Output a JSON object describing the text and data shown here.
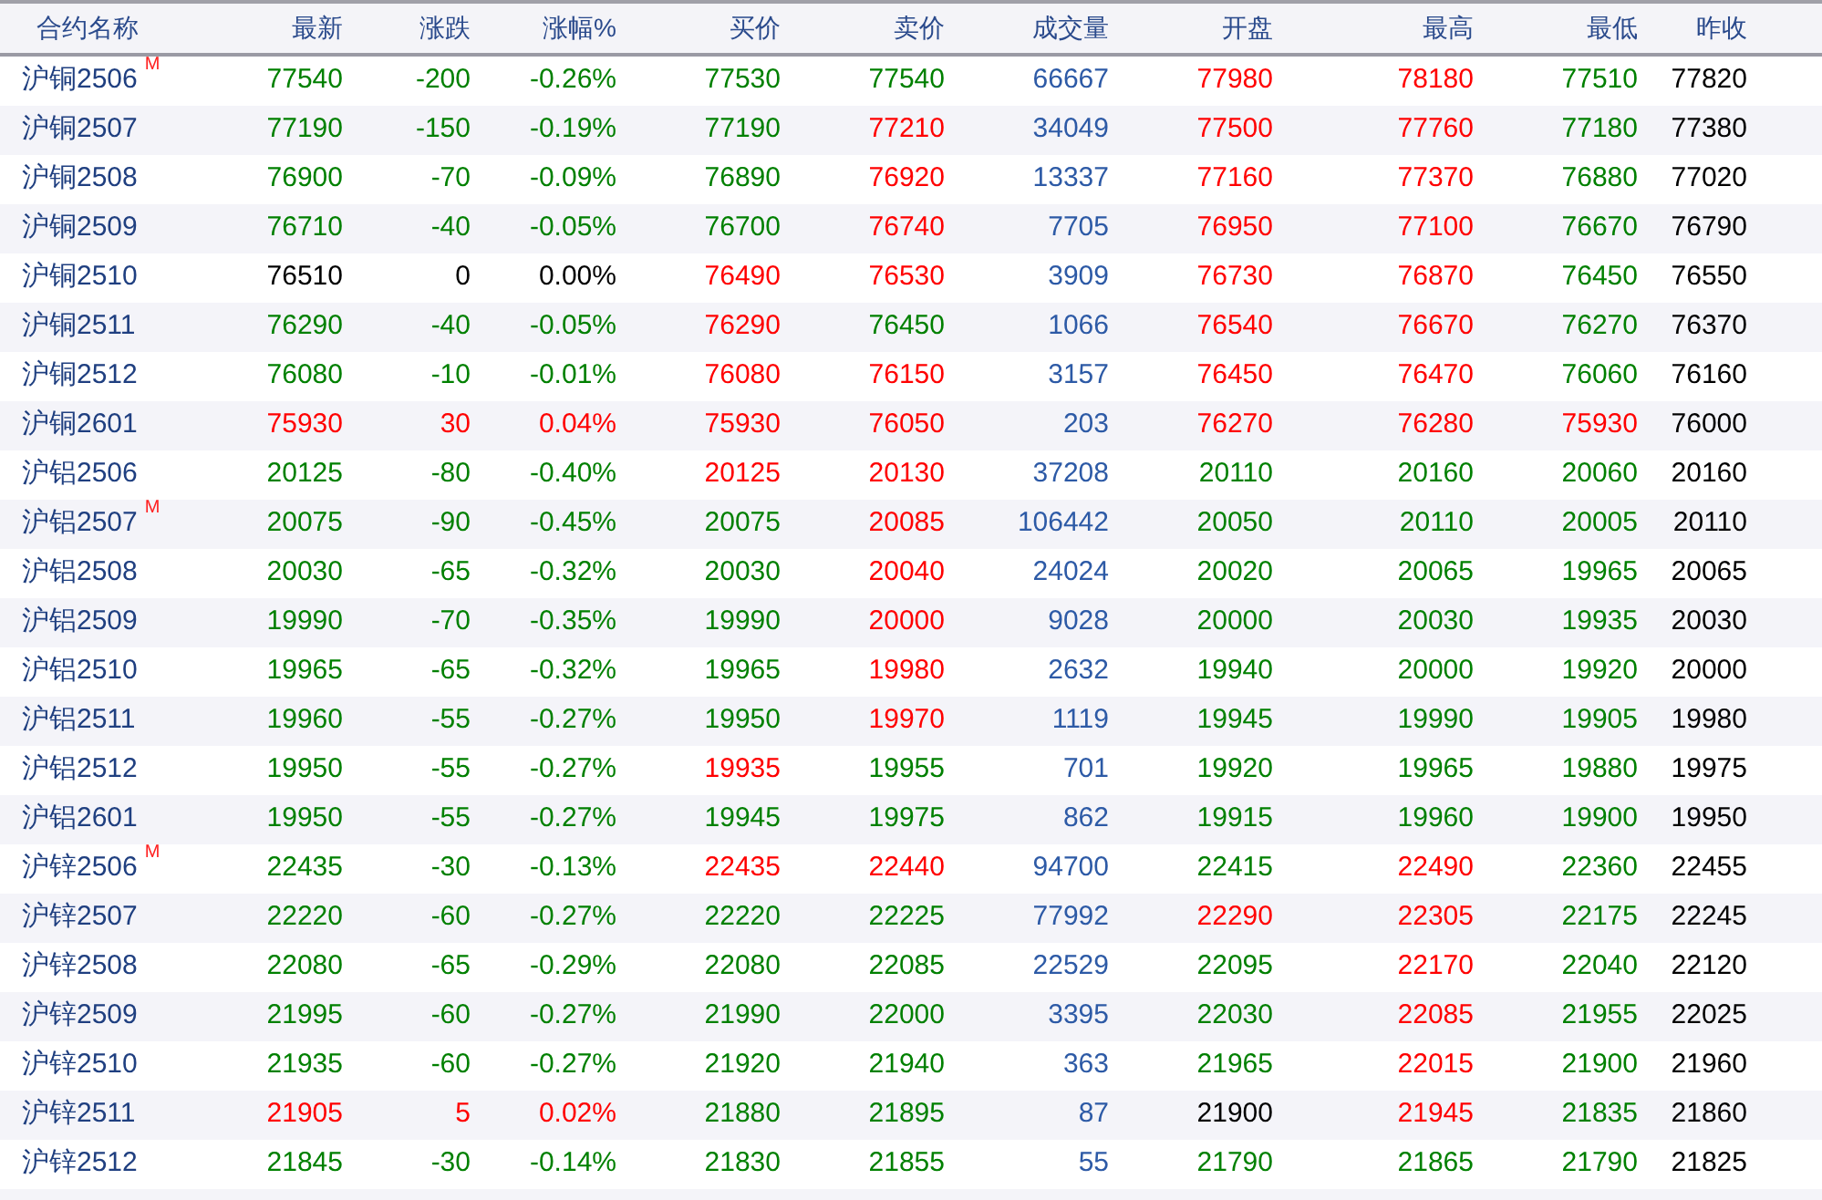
{
  "columns": [
    "合约名称",
    "最新",
    "涨跌",
    "涨幅%",
    "买价",
    "卖价",
    "成交量",
    "开盘",
    "最高",
    "最低",
    "昨收"
  ],
  "rows": [
    {
      "name": "沪铜2506",
      "badge": "M",
      "cells": [
        {
          "text": "77540",
          "color": "#008000"
        },
        {
          "text": "-200",
          "color": "#008000"
        },
        {
          "text": "-0.26%",
          "color": "#008000"
        },
        {
          "text": "77530",
          "color": "#008000"
        },
        {
          "text": "77540",
          "color": "#008000"
        }
      ],
      "volume": "66667",
      "range": [
        {
          "text": "77980",
          "color": "#ff0000"
        },
        {
          "text": "78180",
          "color": "#ff0000"
        },
        {
          "text": "77510",
          "color": "#008000"
        }
      ],
      "prev_close": "77820"
    },
    {
      "name": "沪铜2507",
      "cells": [
        {
          "text": "77190",
          "color": "#008000"
        },
        {
          "text": "-150",
          "color": "#008000"
        },
        {
          "text": "-0.19%",
          "color": "#008000"
        },
        {
          "text": "77190",
          "color": "#008000"
        },
        {
          "text": "77210",
          "color": "#ff0000"
        }
      ],
      "volume": "34049",
      "range": [
        {
          "text": "77500",
          "color": "#ff0000"
        },
        {
          "text": "77760",
          "color": "#ff0000"
        },
        {
          "text": "77180",
          "color": "#008000"
        }
      ],
      "prev_close": "77380"
    },
    {
      "name": "沪铜2508",
      "cells": [
        {
          "text": "76900",
          "color": "#008000"
        },
        {
          "text": "-70",
          "color": "#008000"
        },
        {
          "text": "-0.09%",
          "color": "#008000"
        },
        {
          "text": "76890",
          "color": "#008000"
        },
        {
          "text": "76920",
          "color": "#ff0000"
        }
      ],
      "volume": "13337",
      "range": [
        {
          "text": "77160",
          "color": "#ff0000"
        },
        {
          "text": "77370",
          "color": "#ff0000"
        },
        {
          "text": "76880",
          "color": "#008000"
        }
      ],
      "prev_close": "77020"
    },
    {
      "name": "沪铜2509",
      "cells": [
        {
          "text": "76710",
          "color": "#008000"
        },
        {
          "text": "-40",
          "color": "#008000"
        },
        {
          "text": "-0.05%",
          "color": "#008000"
        },
        {
          "text": "76700",
          "color": "#008000"
        },
        {
          "text": "76740",
          "color": "#ff0000"
        }
      ],
      "volume": "7705",
      "range": [
        {
          "text": "76950",
          "color": "#ff0000"
        },
        {
          "text": "77100",
          "color": "#ff0000"
        },
        {
          "text": "76670",
          "color": "#008000"
        }
      ],
      "prev_close": "76790"
    },
    {
      "name": "沪铜2510",
      "cells": [
        {
          "text": "76510",
          "color": "#000000"
        },
        {
          "text": "0",
          "color": "#000000"
        },
        {
          "text": "0.00%",
          "color": "#000000"
        },
        {
          "text": "76490",
          "color": "#ff0000"
        },
        {
          "text": "76530",
          "color": "#ff0000"
        }
      ],
      "volume": "3909",
      "range": [
        {
          "text": "76730",
          "color": "#ff0000"
        },
        {
          "text": "76870",
          "color": "#ff0000"
        },
        {
          "text": "76450",
          "color": "#008000"
        }
      ],
      "prev_close": "76550"
    },
    {
      "name": "沪铜2511",
      "cells": [
        {
          "text": "76290",
          "color": "#008000"
        },
        {
          "text": "-40",
          "color": "#008000"
        },
        {
          "text": "-0.05%",
          "color": "#008000"
        },
        {
          "text": "76290",
          "color": "#ff0000"
        },
        {
          "text": "76450",
          "color": "#008000"
        }
      ],
      "volume": "1066",
      "range": [
        {
          "text": "76540",
          "color": "#ff0000"
        },
        {
          "text": "76670",
          "color": "#ff0000"
        },
        {
          "text": "76270",
          "color": "#008000"
        }
      ],
      "prev_close": "76370"
    },
    {
      "name": "沪铜2512",
      "cells": [
        {
          "text": "76080",
          "color": "#008000"
        },
        {
          "text": "-10",
          "color": "#008000"
        },
        {
          "text": "-0.01%",
          "color": "#008000"
        },
        {
          "text": "76080",
          "color": "#ff0000"
        },
        {
          "text": "76150",
          "color": "#ff0000"
        }
      ],
      "volume": "3157",
      "range": [
        {
          "text": "76450",
          "color": "#ff0000"
        },
        {
          "text": "76470",
          "color": "#ff0000"
        },
        {
          "text": "76060",
          "color": "#008000"
        }
      ],
      "prev_close": "76160"
    },
    {
      "name": "沪铜2601",
      "cells": [
        {
          "text": "75930",
          "color": "#ff0000"
        },
        {
          "text": "30",
          "color": "#ff0000"
        },
        {
          "text": "0.04%",
          "color": "#ff0000"
        },
        {
          "text": "75930",
          "color": "#ff0000"
        },
        {
          "text": "76050",
          "color": "#ff0000"
        }
      ],
      "volume": "203",
      "range": [
        {
          "text": "76270",
          "color": "#ff0000"
        },
        {
          "text": "76280",
          "color": "#ff0000"
        },
        {
          "text": "75930",
          "color": "#ff0000"
        }
      ],
      "prev_close": "76000"
    },
    {
      "name": "沪铝2506",
      "cells": [
        {
          "text": "20125",
          "color": "#008000"
        },
        {
          "text": "-80",
          "color": "#008000"
        },
        {
          "text": "-0.40%",
          "color": "#008000"
        },
        {
          "text": "20125",
          "color": "#ff0000"
        },
        {
          "text": "20130",
          "color": "#ff0000"
        }
      ],
      "volume": "37208",
      "range": [
        {
          "text": "20110",
          "color": "#008000"
        },
        {
          "text": "20160",
          "color": "#008000"
        },
        {
          "text": "20060",
          "color": "#008000"
        }
      ],
      "prev_close": "20160"
    },
    {
      "name": "沪铝2507",
      "badge": "M",
      "cells": [
        {
          "text": "20075",
          "color": "#008000"
        },
        {
          "text": "-90",
          "color": "#008000"
        },
        {
          "text": "-0.45%",
          "color": "#008000"
        },
        {
          "text": "20075",
          "color": "#008000"
        },
        {
          "text": "20085",
          "color": "#ff0000"
        }
      ],
      "volume": "106442",
      "range": [
        {
          "text": "20050",
          "color": "#008000"
        },
        {
          "text": "20110",
          "color": "#008000"
        },
        {
          "text": "20005",
          "color": "#008000"
        }
      ],
      "prev_close": "20110"
    },
    {
      "name": "沪铝2508",
      "cells": [
        {
          "text": "20030",
          "color": "#008000"
        },
        {
          "text": "-65",
          "color": "#008000"
        },
        {
          "text": "-0.32%",
          "color": "#008000"
        },
        {
          "text": "20030",
          "color": "#008000"
        },
        {
          "text": "20040",
          "color": "#ff0000"
        }
      ],
      "volume": "24024",
      "range": [
        {
          "text": "20020",
          "color": "#008000"
        },
        {
          "text": "20065",
          "color": "#008000"
        },
        {
          "text": "19965",
          "color": "#008000"
        }
      ],
      "prev_close": "20065"
    },
    {
      "name": "沪铝2509",
      "cells": [
        {
          "text": "19990",
          "color": "#008000"
        },
        {
          "text": "-70",
          "color": "#008000"
        },
        {
          "text": "-0.35%",
          "color": "#008000"
        },
        {
          "text": "19990",
          "color": "#008000"
        },
        {
          "text": "20000",
          "color": "#ff0000"
        }
      ],
      "volume": "9028",
      "range": [
        {
          "text": "20000",
          "color": "#008000"
        },
        {
          "text": "20030",
          "color": "#008000"
        },
        {
          "text": "19935",
          "color": "#008000"
        }
      ],
      "prev_close": "20030"
    },
    {
      "name": "沪铝2510",
      "cells": [
        {
          "text": "19965",
          "color": "#008000"
        },
        {
          "text": "-65",
          "color": "#008000"
        },
        {
          "text": "-0.32%",
          "color": "#008000"
        },
        {
          "text": "19965",
          "color": "#008000"
        },
        {
          "text": "19980",
          "color": "#ff0000"
        }
      ],
      "volume": "2632",
      "range": [
        {
          "text": "19940",
          "color": "#008000"
        },
        {
          "text": "20000",
          "color": "#008000"
        },
        {
          "text": "19920",
          "color": "#008000"
        }
      ],
      "prev_close": "20000"
    },
    {
      "name": "沪铝2511",
      "cells": [
        {
          "text": "19960",
          "color": "#008000"
        },
        {
          "text": "-55",
          "color": "#008000"
        },
        {
          "text": "-0.27%",
          "color": "#008000"
        },
        {
          "text": "19950",
          "color": "#008000"
        },
        {
          "text": "19970",
          "color": "#ff0000"
        }
      ],
      "volume": "1119",
      "range": [
        {
          "text": "19945",
          "color": "#008000"
        },
        {
          "text": "19990",
          "color": "#008000"
        },
        {
          "text": "19905",
          "color": "#008000"
        }
      ],
      "prev_close": "19980"
    },
    {
      "name": "沪铝2512",
      "cells": [
        {
          "text": "19950",
          "color": "#008000"
        },
        {
          "text": "-55",
          "color": "#008000"
        },
        {
          "text": "-0.27%",
          "color": "#008000"
        },
        {
          "text": "19935",
          "color": "#ff0000"
        },
        {
          "text": "19955",
          "color": "#008000"
        }
      ],
      "volume": "701",
      "range": [
        {
          "text": "19920",
          "color": "#008000"
        },
        {
          "text": "19965",
          "color": "#008000"
        },
        {
          "text": "19880",
          "color": "#008000"
        }
      ],
      "prev_close": "19975"
    },
    {
      "name": "沪铝2601",
      "cells": [
        {
          "text": "19950",
          "color": "#008000"
        },
        {
          "text": "-55",
          "color": "#008000"
        },
        {
          "text": "-0.27%",
          "color": "#008000"
        },
        {
          "text": "19945",
          "color": "#008000"
        },
        {
          "text": "19975",
          "color": "#008000"
        }
      ],
      "volume": "862",
      "range": [
        {
          "text": "19915",
          "color": "#008000"
        },
        {
          "text": "19960",
          "color": "#008000"
        },
        {
          "text": "19900",
          "color": "#008000"
        }
      ],
      "prev_close": "19950"
    },
    {
      "name": "沪锌2506",
      "badge": "M",
      "cells": [
        {
          "text": "22435",
          "color": "#008000"
        },
        {
          "text": "-30",
          "color": "#008000"
        },
        {
          "text": "-0.13%",
          "color": "#008000"
        },
        {
          "text": "22435",
          "color": "#ff0000"
        },
        {
          "text": "22440",
          "color": "#ff0000"
        }
      ],
      "volume": "94700",
      "range": [
        {
          "text": "22415",
          "color": "#008000"
        },
        {
          "text": "22490",
          "color": "#ff0000"
        },
        {
          "text": "22360",
          "color": "#008000"
        }
      ],
      "prev_close": "22455"
    },
    {
      "name": "沪锌2507",
      "cells": [
        {
          "text": "22220",
          "color": "#008000"
        },
        {
          "text": "-60",
          "color": "#008000"
        },
        {
          "text": "-0.27%",
          "color": "#008000"
        },
        {
          "text": "22220",
          "color": "#008000"
        },
        {
          "text": "22225",
          "color": "#008000"
        }
      ],
      "volume": "77992",
      "range": [
        {
          "text": "22290",
          "color": "#ff0000"
        },
        {
          "text": "22305",
          "color": "#ff0000"
        },
        {
          "text": "22175",
          "color": "#008000"
        }
      ],
      "prev_close": "22245"
    },
    {
      "name": "沪锌2508",
      "cells": [
        {
          "text": "22080",
          "color": "#008000"
        },
        {
          "text": "-65",
          "color": "#008000"
        },
        {
          "text": "-0.29%",
          "color": "#008000"
        },
        {
          "text": "22080",
          "color": "#008000"
        },
        {
          "text": "22085",
          "color": "#008000"
        }
      ],
      "volume": "22529",
      "range": [
        {
          "text": "22095",
          "color": "#008000"
        },
        {
          "text": "22170",
          "color": "#ff0000"
        },
        {
          "text": "22040",
          "color": "#008000"
        }
      ],
      "prev_close": "22120"
    },
    {
      "name": "沪锌2509",
      "cells": [
        {
          "text": "21995",
          "color": "#008000"
        },
        {
          "text": "-60",
          "color": "#008000"
        },
        {
          "text": "-0.27%",
          "color": "#008000"
        },
        {
          "text": "21990",
          "color": "#008000"
        },
        {
          "text": "22000",
          "color": "#008000"
        }
      ],
      "volume": "3395",
      "range": [
        {
          "text": "22030",
          "color": "#008000"
        },
        {
          "text": "22085",
          "color": "#ff0000"
        },
        {
          "text": "21955",
          "color": "#008000"
        }
      ],
      "prev_close": "22025"
    },
    {
      "name": "沪锌2510",
      "cells": [
        {
          "text": "21935",
          "color": "#008000"
        },
        {
          "text": "-60",
          "color": "#008000"
        },
        {
          "text": "-0.27%",
          "color": "#008000"
        },
        {
          "text": "21920",
          "color": "#008000"
        },
        {
          "text": "21940",
          "color": "#008000"
        }
      ],
      "volume": "363",
      "range": [
        {
          "text": "21965",
          "color": "#008000"
        },
        {
          "text": "22015",
          "color": "#ff0000"
        },
        {
          "text": "21900",
          "color": "#008000"
        }
      ],
      "prev_close": "21960"
    },
    {
      "name": "沪锌2511",
      "cells": [
        {
          "text": "21905",
          "color": "#ff0000"
        },
        {
          "text": "5",
          "color": "#ff0000"
        },
        {
          "text": "0.02%",
          "color": "#ff0000"
        },
        {
          "text": "21880",
          "color": "#008000"
        },
        {
          "text": "21895",
          "color": "#008000"
        }
      ],
      "volume": "87",
      "range": [
        {
          "text": "21900",
          "color": "#000000"
        },
        {
          "text": "21945",
          "color": "#ff0000"
        },
        {
          "text": "21835",
          "color": "#008000"
        }
      ],
      "prev_close": "21860"
    },
    {
      "name": "沪锌2512",
      "cells": [
        {
          "text": "21845",
          "color": "#008000"
        },
        {
          "text": "-30",
          "color": "#008000"
        },
        {
          "text": "-0.14%",
          "color": "#008000"
        },
        {
          "text": "21830",
          "color": "#008000"
        },
        {
          "text": "21855",
          "color": "#008000"
        }
      ],
      "volume": "55",
      "range": [
        {
          "text": "21790",
          "color": "#008000"
        },
        {
          "text": "21865",
          "color": "#008000"
        },
        {
          "text": "21790",
          "color": "#008000"
        }
      ],
      "prev_close": "21825"
    }
  ]
}
